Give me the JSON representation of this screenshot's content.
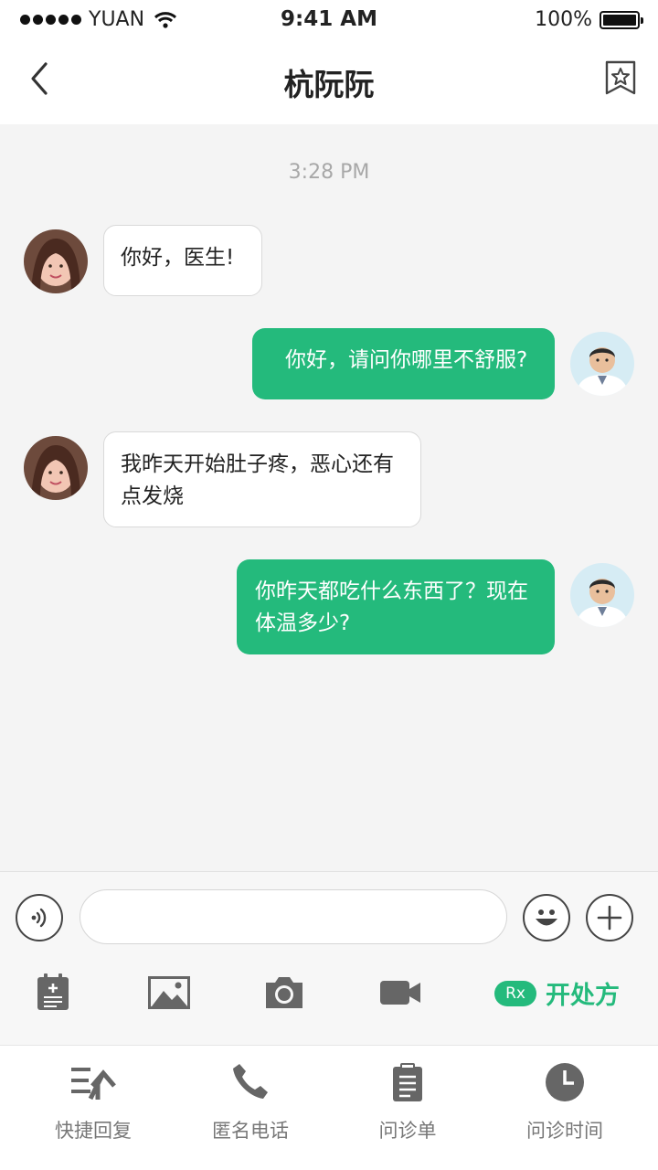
{
  "status_bar": {
    "carrier": "YUAN",
    "time": "9:41 AM",
    "battery": "100%"
  },
  "nav": {
    "title": "杭阮阮"
  },
  "chat": {
    "timestamp": "3:28 PM",
    "messages": [
      {
        "from": "patient",
        "text": "你好，医生!"
      },
      {
        "from": "doctor",
        "text": "你好，请问你哪里不舒服?"
      },
      {
        "from": "patient",
        "text": "我昨天开始肚子疼，恶心还有点发烧"
      },
      {
        "from": "doctor",
        "text": "你昨天都吃什么东西了？现在体温多少?"
      }
    ]
  },
  "input": {
    "placeholder": "",
    "tools": [
      "notes-icon",
      "image-icon",
      "camera-icon",
      "video-icon"
    ],
    "rx_badge": "Rx",
    "rx_label": "开处方"
  },
  "tabs": [
    {
      "label": "快捷回复",
      "icon": "quick-reply-icon"
    },
    {
      "label": "匿名电话",
      "icon": "phone-icon"
    },
    {
      "label": "问诊单",
      "icon": "clipboard-icon"
    },
    {
      "label": "问诊时间",
      "icon": "clock-icon"
    }
  ],
  "colors": {
    "accent": "#24ba7c",
    "background": "#f4f4f4"
  }
}
